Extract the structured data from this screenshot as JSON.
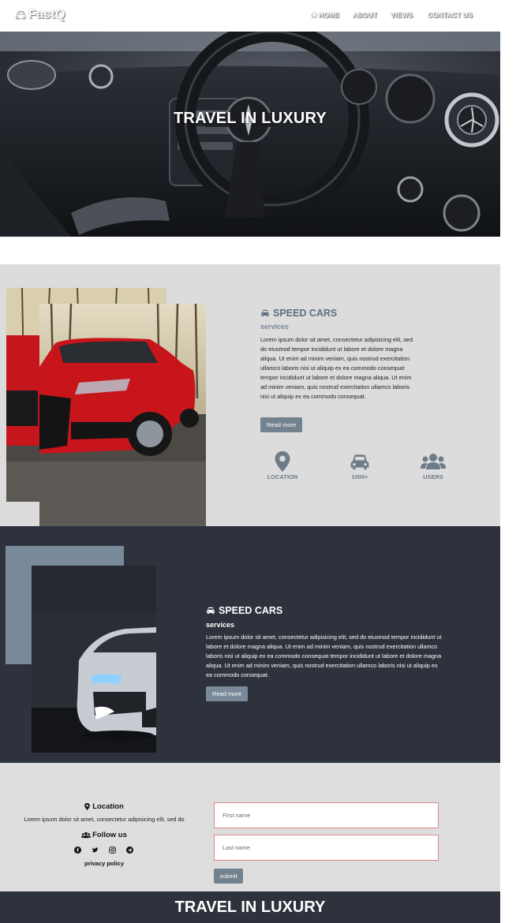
{
  "nav": {
    "brand": "FastQ",
    "links": [
      {
        "label": "HOME",
        "icon": "home-icon"
      },
      {
        "label": "ABOUT"
      },
      {
        "label": "VIEWS"
      },
      {
        "label": "CONTACT US"
      }
    ]
  },
  "hero": {
    "title": "TRAVEL IN LUXURY",
    "image": "car-interior-steering-wheel"
  },
  "section1": {
    "icon": "car-icon",
    "title": "SPEED CARS",
    "subtitle": "services",
    "body": "Lorem ipsum dolor sit amet, consectetur adipisicing elit, sed do eiusmod tempor incididunt ut labore et dolore magna aliqua. Ut enim ad minim veniam, quis nostrud exercitation ullamco laboris nisi ut aliquip ex ea commodo consequat tempor incididunt ut labore et dolore magna aliqua. Ut enim ad minim veniam, quis nostrud exercitation ullamco laboris nisi ut aliquip ex ea commodo consequat.",
    "button": "Read more",
    "image": "red-hatchback-car",
    "stats": [
      {
        "icon": "map-marker-icon",
        "label": "LOCATION"
      },
      {
        "icon": "car-icon",
        "label": "1000+"
      },
      {
        "icon": "users-icon",
        "label": "USERS"
      }
    ]
  },
  "section2": {
    "icon": "car-icon",
    "title": "SPEED CARS",
    "subtitle": "services",
    "body": "Lorem ipsum dolor sit amet, consectetur adipisicing elit, sed do eiusmod tempor incididunt ut labore et dolore magna aliqua. Ut enim ad minim veniam, quis nostrud exercitation ullamco laboris nisi ut aliquip ex ea commodo consequat tempor incididunt ut labore et dolore magna aliqua. Ut enim ad minim veniam, quis nostrud exercitation ullamco laboris nisi ut aliquip ex ea commodo consequat.",
    "button": "Read more",
    "image": "white-sports-car-dark-garage"
  },
  "contact": {
    "location_title": "Location",
    "location_text": "Lorem ipsum dolor sit amet, consectetur adipisicing elit, sed do",
    "follow_title": "Follow us",
    "socials": [
      "facebook-icon",
      "twitter-icon",
      "instagram-icon",
      "telegram-icon"
    ],
    "privacy": "privacy policy",
    "first_name_placeholder": "First name",
    "last_name_placeholder": "Last name",
    "submit": "submit"
  },
  "footer": {
    "title": "TRAVEL IN LUXURY"
  },
  "colors": {
    "accent": "#73828f",
    "dark_section": "#2d323c",
    "light_section": "#dcdcdc",
    "title_blue": "#5e6d7e",
    "input_border": "#d98c8c"
  }
}
